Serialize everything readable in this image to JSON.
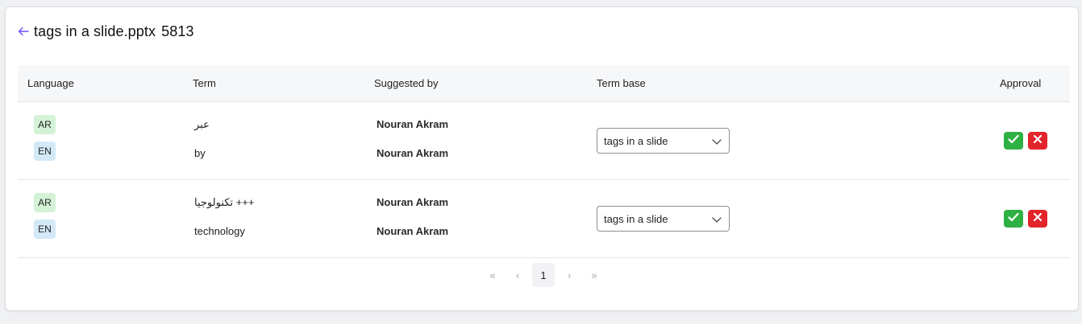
{
  "header": {
    "title": "tags in a slide.pptx",
    "id": "5813"
  },
  "table": {
    "columns": {
      "language": "Language",
      "term": "Term",
      "suggested_by": "Suggested by",
      "term_base": "Term base",
      "approval": "Approval"
    },
    "rows": [
      {
        "ar": {
          "lang": "AR",
          "term": "عبر",
          "suggested_by": "Nouran Akram"
        },
        "en": {
          "lang": "EN",
          "term": "by",
          "suggested_by": "Nouran Akram"
        },
        "term_base": "tags in a slide"
      },
      {
        "ar": {
          "lang": "AR",
          "term": "+++ تكنولوجيا",
          "suggested_by": "Nouran Akram"
        },
        "en": {
          "lang": "EN",
          "term": "technology",
          "suggested_by": "Nouran Akram"
        },
        "term_base": "tags in a slide"
      }
    ]
  },
  "pagination": {
    "first": "«",
    "prev": "‹",
    "current": "1",
    "next": "›",
    "last": "»"
  },
  "colors": {
    "accent_back": "#6b4cff",
    "approve": "#2fb043",
    "reject": "#e3242b",
    "badge_ar": "#d3f2d6",
    "badge_en": "#d3e9f7"
  },
  "icons": {
    "back": "arrow-left-icon",
    "approve": "check-icon",
    "reject": "x-icon",
    "dropdown": "chevron-down-icon"
  }
}
